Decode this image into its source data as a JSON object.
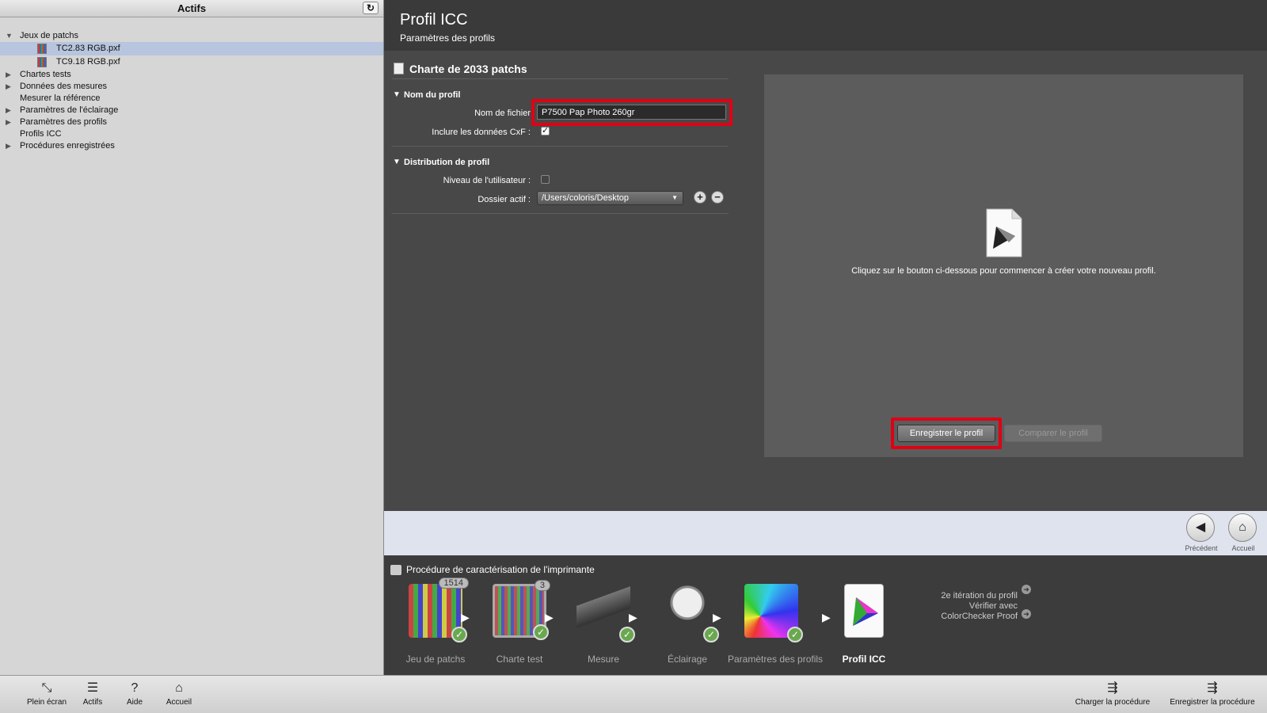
{
  "sidebar": {
    "title": "Actifs",
    "tree": [
      {
        "label": "Jeux de patchs",
        "expanded": true
      },
      {
        "label": "TC2.83 RGB.pxf",
        "child": true,
        "selected": true
      },
      {
        "label": "TC9.18 RGB.pxf",
        "child": true
      },
      {
        "label": "Chartes tests"
      },
      {
        "label": "Données des mesures"
      },
      {
        "label": "Mesurer la référence"
      },
      {
        "label": "Paramètres de l'éclairage"
      },
      {
        "label": "Paramètres des profils"
      },
      {
        "label": "Profils ICC"
      },
      {
        "label": "Procédures enregistrées"
      }
    ]
  },
  "header": {
    "title": "Profil ICC",
    "subtitle": "Paramètres des profils"
  },
  "form": {
    "title": "Charte de 2033 patchs",
    "section1": "Nom du profil",
    "filename_label": "Nom de fichier",
    "filename_value": "P7500 Pap Photo 260gr",
    "cxf_label": "Inclure les données CxF :",
    "section2": "Distribution de profil",
    "user_level_label": "Niveau de l'utilisateur :",
    "folder_label": "Dossier actif :",
    "folder_value": "/Users/coloris/Desktop"
  },
  "panel": {
    "message": "Cliquez sur le bouton ci-dessous pour commencer à créer votre nouveau profil.",
    "save_button": "Enregistrer le profil",
    "compare_button": "Comparer le profil"
  },
  "nav": {
    "back_label": "Précédent",
    "home_label": "Accueil"
  },
  "workflow": {
    "title": "Procédure de caractérisation de l'imprimante",
    "steps": [
      {
        "label": "Jeu de patchs",
        "badge": "1514"
      },
      {
        "label": "Charte test",
        "badge": "3"
      },
      {
        "label": "Mesure"
      },
      {
        "label": "Éclairage"
      },
      {
        "label": "Paramètres des profils"
      },
      {
        "label": "Profil ICC"
      }
    ],
    "iteration": "2e itération du profil",
    "verify": "Vérifier avec ColorChecker Proof"
  },
  "bottom": {
    "fullscreen": "Plein écran",
    "assets": "Actifs",
    "help": "Aide",
    "home": "Accueil",
    "load_proc": "Charger la procédure",
    "save_proc": "Enregistrer la procédure"
  },
  "colors": {
    "highlight": "#e00014",
    "ok": "#6aa84f",
    "selection": "#b7c5de"
  }
}
